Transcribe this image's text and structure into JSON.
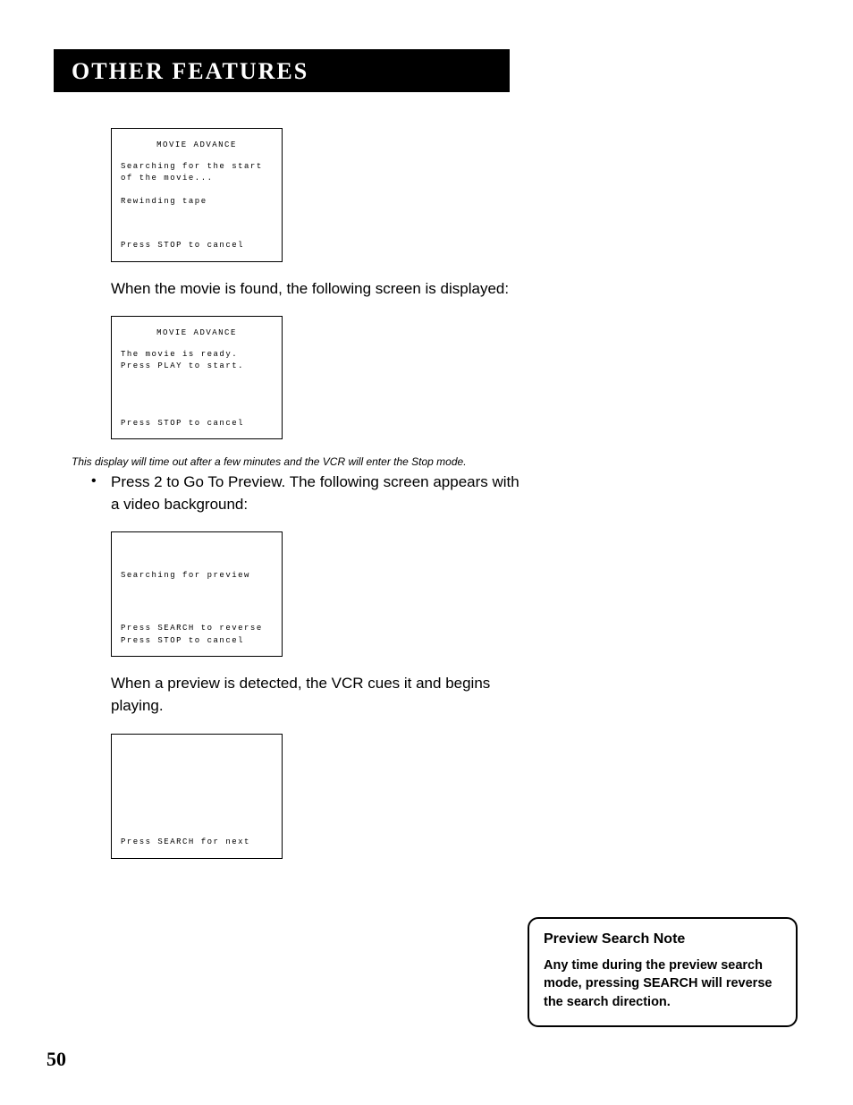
{
  "header": {
    "title": "OTHER FEATURES"
  },
  "osd1": {
    "title": "MOVIE ADVANCE",
    "line1": "Searching for the start",
    "line2": "of the movie...",
    "line3": "Rewinding tape",
    "line4": "Press STOP to cancel"
  },
  "para1": "When the movie is found, the following screen is displayed:",
  "osd2": {
    "title": "MOVIE ADVANCE",
    "line1": "The movie is ready.",
    "line2": "Press PLAY to start.",
    "line3": "Press STOP to cancel"
  },
  "note": "This display will time out after a few minutes and the VCR will enter the Stop mode.",
  "bullet1": "Press 2 to Go To Preview. The following screen appears with a video background:",
  "osd3": {
    "line1": "Searching for preview",
    "line2": "Press SEARCH to reverse",
    "line3": "Press STOP to cancel"
  },
  "para2": "When a preview is detected, the VCR cues it and begins playing.",
  "osd4": {
    "line1": "Press SEARCH for next"
  },
  "sidenote": {
    "title": "Preview Search Note",
    "body": "Any time during the preview search mode, pressing SEARCH will reverse the search direction."
  },
  "pagenum": "50"
}
